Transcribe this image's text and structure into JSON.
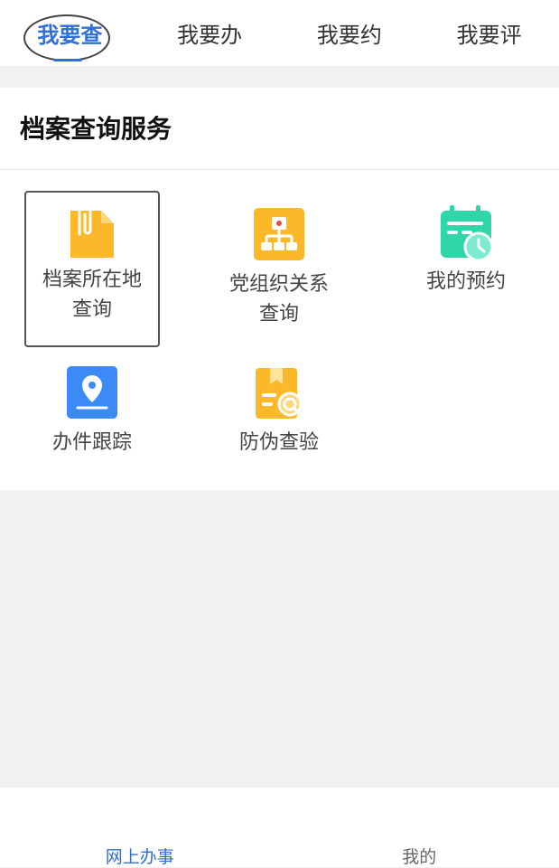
{
  "tabs": [
    {
      "label": "我要查",
      "active": true
    },
    {
      "label": "我要办"
    },
    {
      "label": "我要约"
    },
    {
      "label": "我要评"
    }
  ],
  "section": {
    "title": "档案查询服务"
  },
  "services": [
    {
      "label": "档案所在地查询",
      "icon": "document-clip-icon",
      "color": "#FBB92A"
    },
    {
      "label": "党组织关系查询",
      "icon": "party-org-icon",
      "color": "#FBB92A"
    },
    {
      "label": "我的预约",
      "icon": "calendar-clock-icon",
      "color": "#2ED6A8"
    },
    {
      "label": "办件跟踪",
      "icon": "location-pin-icon",
      "color": "#3C8AF5"
    },
    {
      "label": "防伪查验",
      "icon": "verify-search-icon",
      "color": "#FBB92A"
    }
  ],
  "bottom_nav": [
    {
      "label": "网上办事",
      "active": true
    },
    {
      "label": "我的"
    }
  ],
  "colors": {
    "accent": "#2f6fd6",
    "background": "#f1f1f1"
  }
}
